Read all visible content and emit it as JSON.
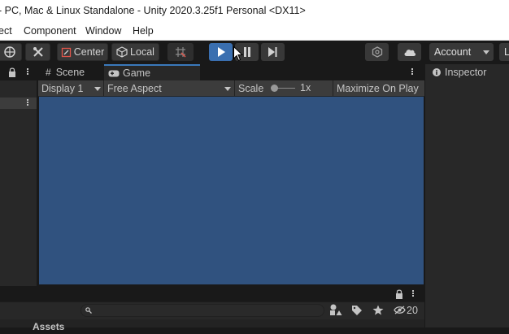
{
  "window": {
    "title": "- PC, Mac & Linux Standalone - Unity 2020.3.25f1 Personal <DX11>"
  },
  "menu": [
    "ect",
    "Component",
    "Window",
    "Help"
  ],
  "toolbar": {
    "center_label": "Center",
    "local_label": "Local",
    "account_label": "Account",
    "layers_label": "L"
  },
  "tabs": {
    "scene": "Scene",
    "game": "Game",
    "inspector": "Inspector"
  },
  "game_toolbar": {
    "display": "Display 1",
    "aspect": "Free Aspect",
    "scale_label": "Scale",
    "scale_value": "1x",
    "maximize": "Maximize On Play"
  },
  "project": {
    "hidden_count": "20",
    "assets_label": "Assets"
  },
  "colors": {
    "game_bg": "#30527f",
    "play_active": "#3a6fb0",
    "tab_accent": "#3a79bb"
  }
}
